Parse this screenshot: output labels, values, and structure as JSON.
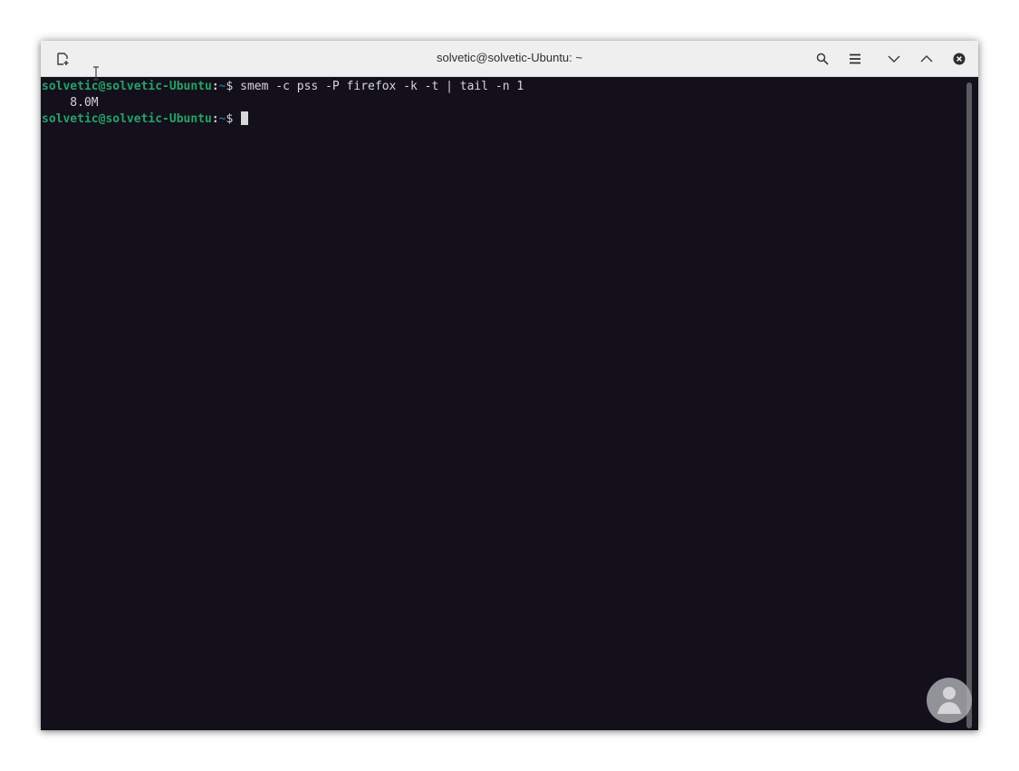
{
  "window": {
    "title": "solvetic@solvetic-Ubuntu: ~"
  },
  "titlebar": {
    "icons": [
      "new-tab-icon",
      "search-icon",
      "hamburger-menu-icon",
      "minimize-icon",
      "maximize-icon",
      "close-icon"
    ]
  },
  "terminal": {
    "lines": [
      {
        "user": "solvetic@solvetic-Ubuntu",
        "sep": ":",
        "path": "~",
        "symbol": "$ ",
        "command": "smem -c pss -P firefox -k -t | tail -n 1"
      },
      {
        "output": "    8.0M"
      },
      {
        "user": "solvetic@solvetic-Ubuntu",
        "sep": ":",
        "path": "~",
        "symbol": "$ ",
        "command": ""
      }
    ]
  },
  "colors": {
    "terminal_bg": "#13101b",
    "prompt_user": "#26a269",
    "prompt_path": "#3465a4",
    "text": "#d6d6d6",
    "titlebar_bg": "#efefef"
  }
}
